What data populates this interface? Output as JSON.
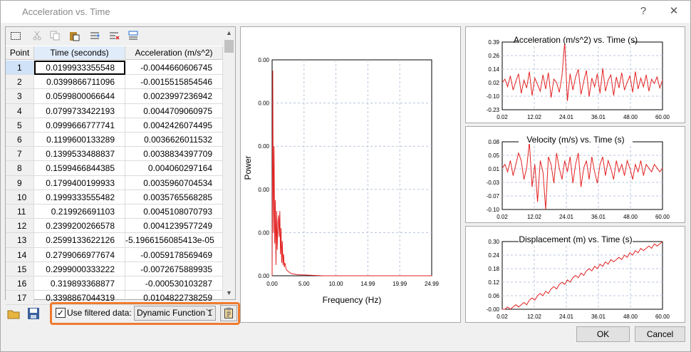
{
  "window": {
    "title": "Acceleration vs. Time",
    "help": "?",
    "close": "✕"
  },
  "table": {
    "columns": [
      "Point",
      "Time (seconds)",
      "Acceleration (m/s^2)"
    ],
    "rows": [
      [
        "1",
        "0.0199933355548",
        "-0.0044660606745"
      ],
      [
        "2",
        "0.0399866711096",
        "-0.0015515854546"
      ],
      [
        "3",
        "0.0599800066644",
        "0.0023997236942"
      ],
      [
        "4",
        "0.0799733422193",
        "0.0044709060975"
      ],
      [
        "5",
        "0.0999666777741",
        "0.0042426074495"
      ],
      [
        "6",
        "0.1199600133289",
        "0.0036626011532"
      ],
      [
        "7",
        "0.1399533488837",
        "0.0038834397709"
      ],
      [
        "8",
        "0.1599466844385",
        "0.004060297164"
      ],
      [
        "9",
        "0.1799400199933",
        "0.0035960704534"
      ],
      [
        "10",
        "0.1999333555482",
        "0.0035765568285"
      ],
      [
        "11",
        "0.219926691103",
        "0.0045108070793"
      ],
      [
        "12",
        "0.2399200266578",
        "0.0041239577249"
      ],
      [
        "13",
        "0.2599133622126",
        "-5.1966156085413e-05"
      ],
      [
        "14",
        "0.2799066977674",
        "-0.0059178569469"
      ],
      [
        "15",
        "0.2999000333222",
        "-0.0072675889935"
      ],
      [
        "16",
        "0.319893368877",
        "-0.000530103287"
      ],
      [
        "17",
        "0.3398867044319",
        "0.0104822738259"
      ]
    ],
    "selected_row": 0
  },
  "filter": {
    "checked": true,
    "checkbox_label": "Use filtered data:",
    "function_value": "Dynamic Function 1"
  },
  "buttons": {
    "ok": "OK",
    "cancel": "Cancel"
  },
  "colors": {
    "series": "#e32222",
    "accent": "#ef7a2f",
    "grid": "#b8c4dc"
  },
  "chart_data": [
    {
      "type": "line",
      "title": "",
      "xlabel": "Frequency (Hz)",
      "ylabel": "Power",
      "xticks": [
        "0.00",
        "5.00",
        "10.00",
        "14.99",
        "19.99",
        "24.99"
      ],
      "yticks": [
        "0.00",
        "0.00",
        "0.00",
        "0.00",
        "0.00",
        "0.00"
      ],
      "xlim": [
        0,
        24.99
      ],
      "grid": true,
      "series": [
        {
          "points": [
            [
              0.0,
              0.0
            ],
            [
              0.1,
              0.95
            ],
            [
              0.2,
              0.2
            ],
            [
              0.3,
              0.6
            ],
            [
              0.4,
              0.15
            ],
            [
              0.5,
              0.35
            ],
            [
              0.6,
              0.05
            ],
            [
              0.7,
              0.3
            ],
            [
              0.8,
              0.12
            ],
            [
              0.9,
              0.25
            ],
            [
              1.0,
              0.28
            ],
            [
              1.1,
              0.18
            ],
            [
              1.2,
              0.3
            ],
            [
              1.3,
              0.1
            ],
            [
              1.4,
              0.22
            ],
            [
              1.5,
              0.06
            ],
            [
              1.6,
              0.16
            ],
            [
              1.7,
              0.05
            ],
            [
              1.8,
              0.1
            ],
            [
              1.9,
              0.04
            ],
            [
              2.0,
              0.06
            ],
            [
              2.2,
              0.03
            ],
            [
              2.5,
              0.02
            ],
            [
              3.0,
              0.01
            ],
            [
              4.0,
              0.005
            ],
            [
              8.0,
              0.0
            ],
            [
              24.99,
              0.0
            ]
          ]
        }
      ]
    },
    {
      "type": "line",
      "title": "Acceleration (m/s^2) vs. Time (s)",
      "xticks": [
        "0.02",
        "12.02",
        "24.01",
        "36.01",
        "48.00",
        "60.00"
      ],
      "yticks": [
        "0.39",
        "0.26",
        "0.14",
        "0.02",
        "-0.10",
        "-0.23"
      ],
      "xlim": [
        0.02,
        60.0
      ],
      "ylim": [
        -0.23,
        0.39
      ],
      "grid": true,
      "series": [
        {
          "values": [
            0.02,
            0.05,
            -0.02,
            0.08,
            -0.05,
            0.03,
            0.1,
            -0.08,
            0.04,
            -0.03,
            0.12,
            -0.1,
            0.06,
            0.0,
            -0.06,
            0.09,
            -0.04,
            0.11,
            -0.12,
            0.05,
            0.02,
            -0.07,
            0.08,
            0.39,
            -0.15,
            0.1,
            -0.05,
            0.07,
            0.14,
            -0.09,
            0.03,
            0.13,
            -0.11,
            0.06,
            -0.02,
            0.1,
            -0.08,
            0.15,
            -0.06,
            0.04,
            0.09,
            -0.1,
            0.07,
            -0.03,
            0.11,
            -0.05,
            0.02,
            0.08,
            -0.07,
            0.12,
            -0.04,
            0.06,
            -0.02,
            0.09,
            -0.06,
            0.05,
            0.01,
            0.07,
            -0.03,
            0.04
          ]
        }
      ]
    },
    {
      "type": "line",
      "title": "Velocity (m/s) vs. Time (s)",
      "xticks": [
        "0.02",
        "12.02",
        "24.01",
        "36.01",
        "48.00",
        "60.00"
      ],
      "yticks": [
        "0.08",
        "0.05",
        "0.01",
        "-0.03",
        "-0.07",
        "-0.10"
      ],
      "xlim": [
        0.02,
        60.0
      ],
      "ylim": [
        -0.1,
        0.08
      ],
      "grid": true,
      "series": [
        {
          "values": [
            0.01,
            0.02,
            0.0,
            0.03,
            -0.01,
            0.02,
            0.05,
            0.03,
            -0.02,
            0.01,
            0.08,
            -0.04,
            0.02,
            -0.08,
            0.03,
            0.0,
            -0.1,
            0.04,
            0.02,
            -0.03,
            0.05,
            0.01,
            -0.02,
            0.03,
            0.0,
            0.04,
            -0.03,
            0.02,
            0.05,
            -0.04,
            0.01,
            0.03,
            -0.02,
            0.04,
            0.0,
            -0.03,
            0.02,
            0.04,
            -0.01,
            0.03,
            0.01,
            -0.02,
            0.03,
            0.0,
            0.02,
            -0.01,
            0.03,
            0.01,
            -0.02,
            0.02,
            0.0,
            0.03,
            -0.01,
            0.02,
            0.01,
            0.0,
            0.02,
            0.01,
            0.0,
            0.01
          ]
        }
      ]
    },
    {
      "type": "line",
      "title": "Displacement (m) vs. Time (s)",
      "xticks": [
        "0.02",
        "12.02",
        "24.01",
        "36.01",
        "48.00",
        "60.00"
      ],
      "yticks": [
        "0.30",
        "0.24",
        "0.18",
        "0.12",
        "0.06",
        "-0.00"
      ],
      "xlim": [
        0.02,
        60.0
      ],
      "ylim": [
        0.0,
        0.3
      ],
      "grid": true,
      "series": [
        {
          "values": [
            0.0,
            0.0,
            0.01,
            0.0,
            0.01,
            0.02,
            0.01,
            0.02,
            0.03,
            0.02,
            0.04,
            0.05,
            0.04,
            0.06,
            0.07,
            0.06,
            0.08,
            0.07,
            0.09,
            0.1,
            0.09,
            0.11,
            0.12,
            0.11,
            0.13,
            0.12,
            0.14,
            0.15,
            0.14,
            0.16,
            0.15,
            0.17,
            0.18,
            0.17,
            0.19,
            0.18,
            0.2,
            0.19,
            0.21,
            0.2,
            0.22,
            0.21,
            0.22,
            0.23,
            0.22,
            0.24,
            0.23,
            0.25,
            0.24,
            0.26,
            0.25,
            0.27,
            0.26,
            0.27,
            0.28,
            0.27,
            0.29,
            0.28,
            0.29,
            0.3
          ]
        }
      ]
    }
  ]
}
